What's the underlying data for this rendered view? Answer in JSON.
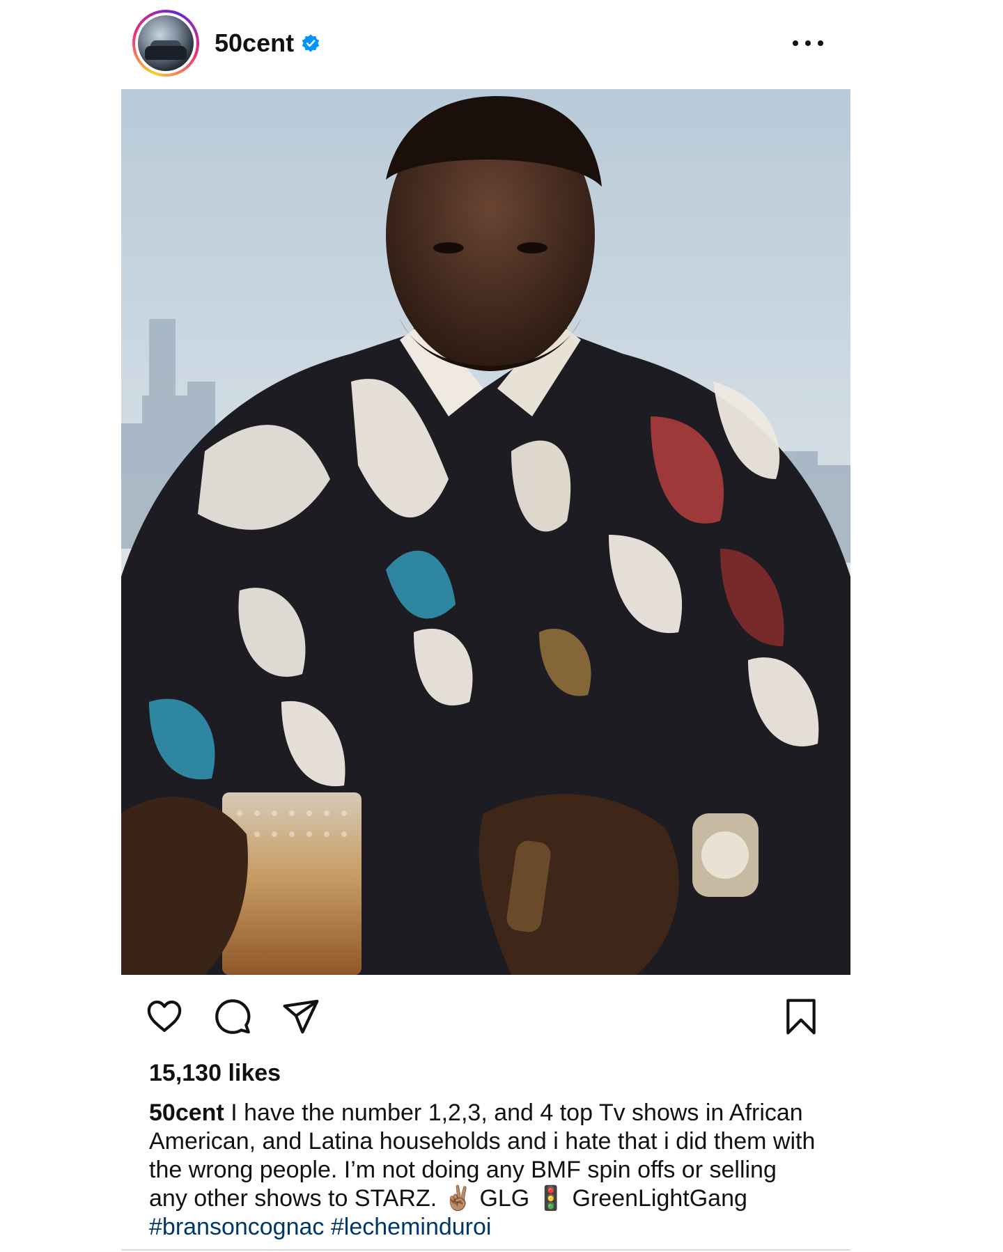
{
  "post": {
    "username": "50cent",
    "verified": true,
    "more_icon": "more-horizontal-icon",
    "image_alt": "Photo post",
    "likes_text": "15,130 likes",
    "caption": {
      "username": "50cent",
      "text": "I have the number 1,2,3, and 4 top Tv shows in African American, and Latina households and i hate that i did them with the wrong people. I’m not doing any BMF spin offs or selling any other shows to STARZ.",
      "emoji_1": "✌🏽",
      "after_emoji": "GLG",
      "emoji_2": "🚦",
      "after_emoji_2": "GreenLightGang",
      "hashtag_1": "#bransoncognac",
      "hashtag_2": "#lecheminduroi"
    },
    "actions": {
      "like_icon": "heart-icon",
      "comment_icon": "comment-icon",
      "share_icon": "send-icon",
      "save_icon": "bookmark-icon"
    }
  },
  "colors": {
    "link": "#00376b",
    "verified": "#0095f6",
    "text": "#111111"
  }
}
